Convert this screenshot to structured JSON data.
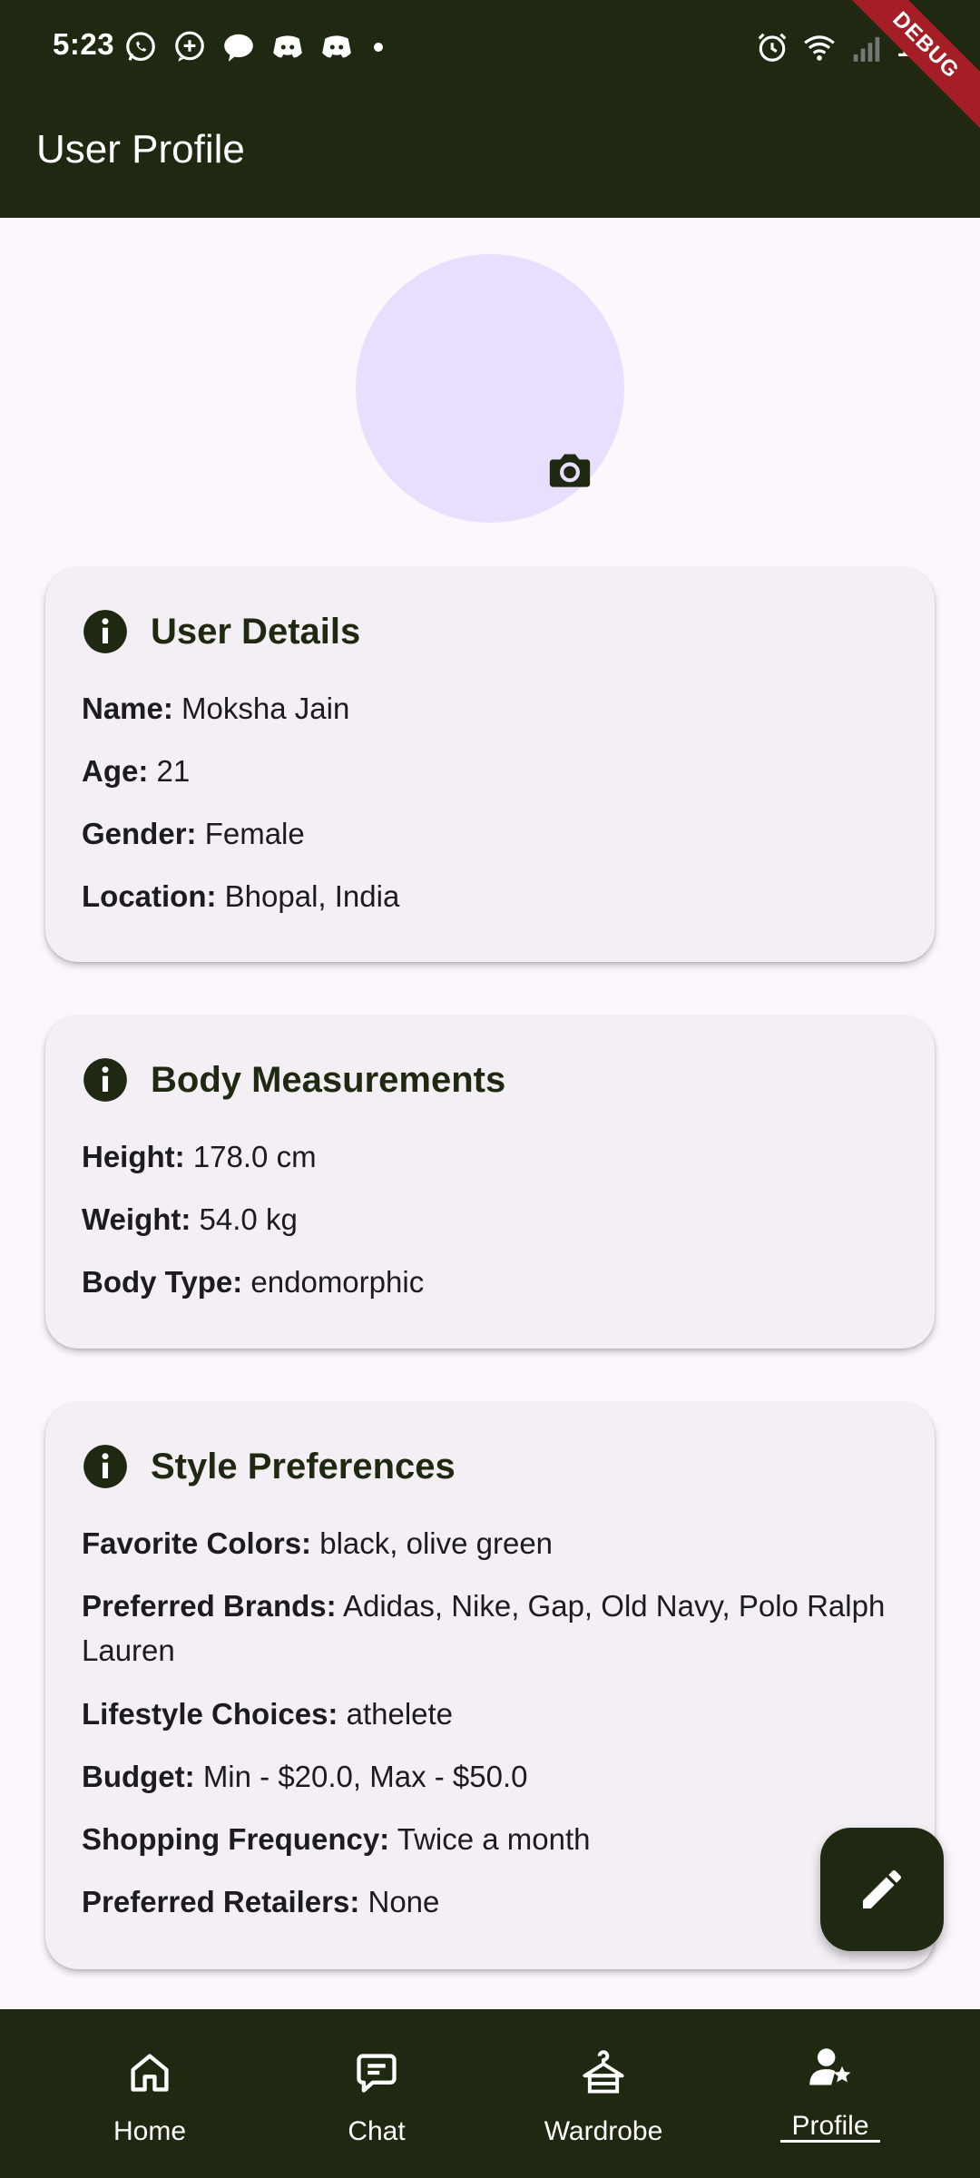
{
  "status_bar": {
    "time": "5:23",
    "battery": "100",
    "left_icons": [
      "whatsapp-icon",
      "message-plus-icon",
      "chat-icon",
      "discord-icon",
      "discord-icon",
      "dot-icon"
    ],
    "right_icons": [
      "alarm-icon",
      "wifi-icon",
      "signal-icon"
    ]
  },
  "debug_banner": "DEBUG",
  "app_bar": {
    "title": "User Profile"
  },
  "user_details": {
    "title": "User Details",
    "rows": [
      {
        "label": "Name:",
        "value": "Moksha Jain"
      },
      {
        "label": "Age:",
        "value": "21"
      },
      {
        "label": "Gender:",
        "value": "Female"
      },
      {
        "label": "Location:",
        "value": "Bhopal, India"
      }
    ]
  },
  "body_measurements": {
    "title": "Body Measurements",
    "rows": [
      {
        "label": "Height:",
        "value": "178.0 cm"
      },
      {
        "label": "Weight:",
        "value": "54.0 kg"
      },
      {
        "label": "Body Type:",
        "value": "endomorphic"
      }
    ]
  },
  "style_preferences": {
    "title": "Style Preferences",
    "rows": [
      {
        "label": "Favorite Colors:",
        "value": "black, olive green"
      },
      {
        "label": "Preferred Brands:",
        "value": "Adidas, Nike, Gap, Old Navy, Polo Ralph Lauren"
      },
      {
        "label": "Lifestyle Choices:",
        "value": "athelete"
      },
      {
        "label": "Budget:",
        "value": "Min - $20.0, Max - $50.0"
      },
      {
        "label": "Shopping Frequency:",
        "value": "Twice a month"
      },
      {
        "label": "Preferred Retailers:",
        "value": "None"
      }
    ]
  },
  "bottom_nav": {
    "items": [
      {
        "label": "Home",
        "icon": "home-icon"
      },
      {
        "label": "Chat",
        "icon": "chat-icon"
      },
      {
        "label": "Wardrobe",
        "icon": "hanger-icon"
      },
      {
        "label": "Profile",
        "icon": "profile-icon",
        "selected": true
      }
    ]
  },
  "colors": {
    "app_bar": "#1F2811",
    "background": "#FCF7FD",
    "card": "#F4EFF5",
    "avatar": "#E8DEFD",
    "debug": "#A51D25"
  }
}
